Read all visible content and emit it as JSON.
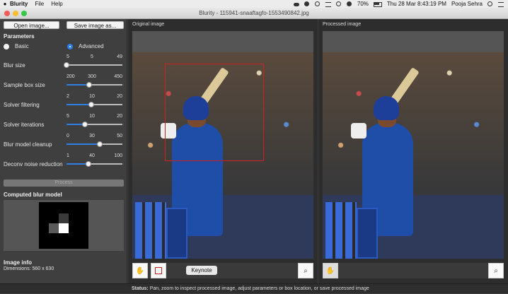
{
  "menubar": {
    "app_name": "Blurity",
    "menus": [
      "File",
      "Help"
    ],
    "battery": "70%",
    "datetime": "Thu 28 Mar  8:43:19 PM",
    "user": "Pooja Sehra"
  },
  "window": {
    "title": "Blurity - 115941-snaaftagfo-1553490842.jpg"
  },
  "toolbar": {
    "open_label": "Open image...",
    "save_label": "Save image as..."
  },
  "parameters": {
    "heading": "Parameters",
    "mode_basic": "Basic",
    "mode_advanced": "Advanced",
    "selected_mode": "Advanced",
    "sliders": [
      {
        "label": "Blur size",
        "min": "5",
        "value": "5",
        "max": "49",
        "fraction": 0.0
      },
      {
        "label": "Sample box size",
        "min": "200",
        "value": "300",
        "max": "450",
        "fraction": 0.4
      },
      {
        "label": "Solver filtering",
        "min": "2",
        "value": "10",
        "max": "20",
        "fraction": 0.44
      },
      {
        "label": "Solver iterations",
        "min": "5",
        "value": "10",
        "max": "20",
        "fraction": 0.33
      },
      {
        "label": "Blur model cleanup",
        "min": "0",
        "value": "30",
        "max": "50",
        "fraction": 0.6
      },
      {
        "label": "Deconv noise reduction",
        "min": "1",
        "value": "40",
        "max": "100",
        "fraction": 0.39
      }
    ]
  },
  "process_label": "Process",
  "blur_model": {
    "heading": "Computed blur model"
  },
  "image_info": {
    "heading": "Image info",
    "dimensions": "Dimensions:  560 x 630"
  },
  "panels": {
    "original_title": "Original image",
    "processed_title": "Processed image",
    "keynote_label": "Keynote"
  },
  "status": {
    "label": "Status:",
    "text": "Pan, zoom to inspect processed image, adjust parameters or box location, or save processed image"
  },
  "colors": {
    "accent": "#2f7fe6",
    "selection_box": "#d02020"
  }
}
